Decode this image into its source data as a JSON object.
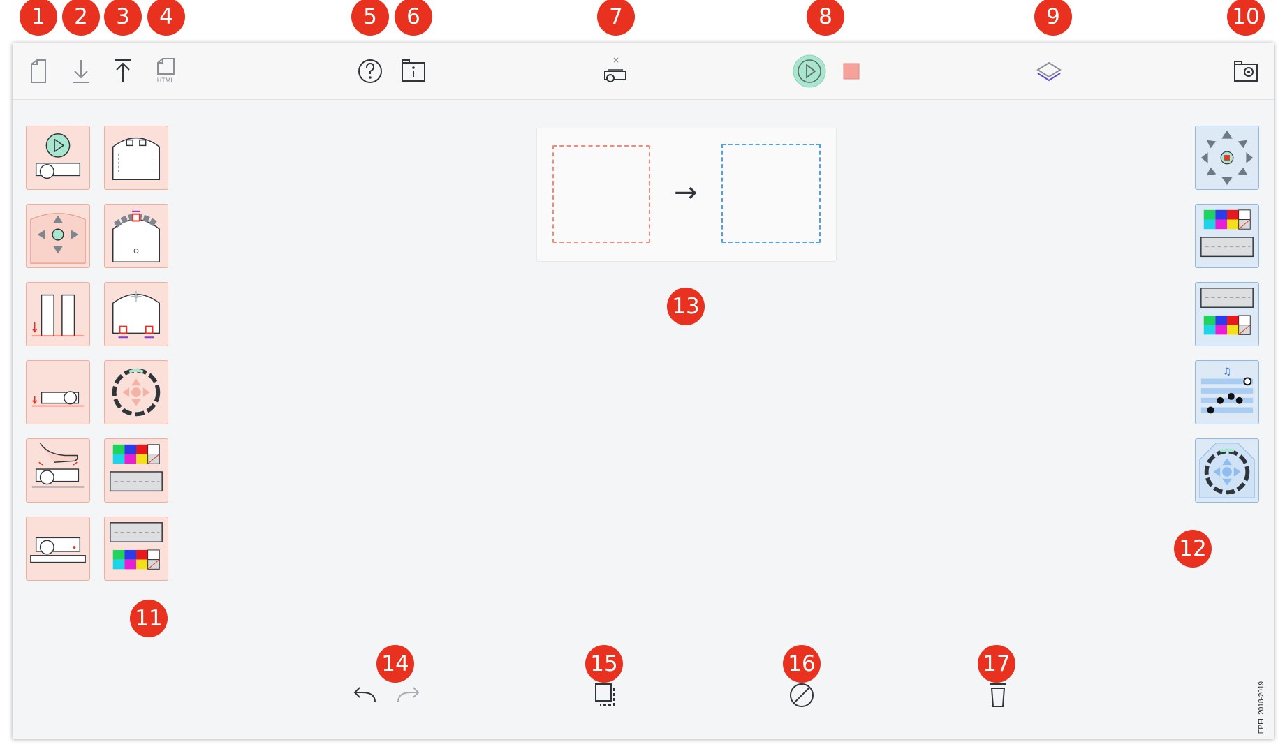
{
  "badges": [
    "1",
    "2",
    "3",
    "4",
    "5",
    "6",
    "7",
    "8",
    "9",
    "10",
    "11",
    "12",
    "13",
    "14",
    "15",
    "16",
    "17"
  ],
  "toolbar": {
    "items": [
      {
        "icon": "new-file-icon"
      },
      {
        "icon": "download-icon"
      },
      {
        "icon": "upload-icon"
      },
      {
        "icon": "html-export-icon",
        "label": "HTML"
      },
      {
        "icon": "help-icon"
      },
      {
        "icon": "info-icon"
      },
      {
        "icon": "robot-disconnected-icon",
        "status": "×"
      },
      {
        "icon": "play-icon"
      },
      {
        "icon": "stop-icon"
      },
      {
        "icon": "layers-icon"
      },
      {
        "icon": "settings-icon"
      }
    ]
  },
  "events_palette": [
    "start-event",
    "button-event",
    "horizontal-prox-event",
    "ground-event",
    "tap-event",
    "clap-event",
    "timer-event",
    "ground-cliff-event",
    "color-top-event",
    "color-bottom-event",
    "motor-event",
    "remote-event"
  ],
  "actions_palette": [
    "motor-action",
    "top-color-action",
    "bottom-color-action",
    "music-action",
    "timer-action"
  ],
  "rule": {
    "arrow": "→"
  },
  "bottom_toolbar": [
    "undo-icon",
    "redo-icon",
    "duplicate-icon",
    "disable-icon",
    "trash-icon"
  ],
  "credit": "EPFL 2018-2019",
  "colors": {
    "accent_red": "#e8321f",
    "event_bg": "#fbe0d9",
    "action_bg": "#dde9f5",
    "play_green": "#a8e6cf"
  }
}
